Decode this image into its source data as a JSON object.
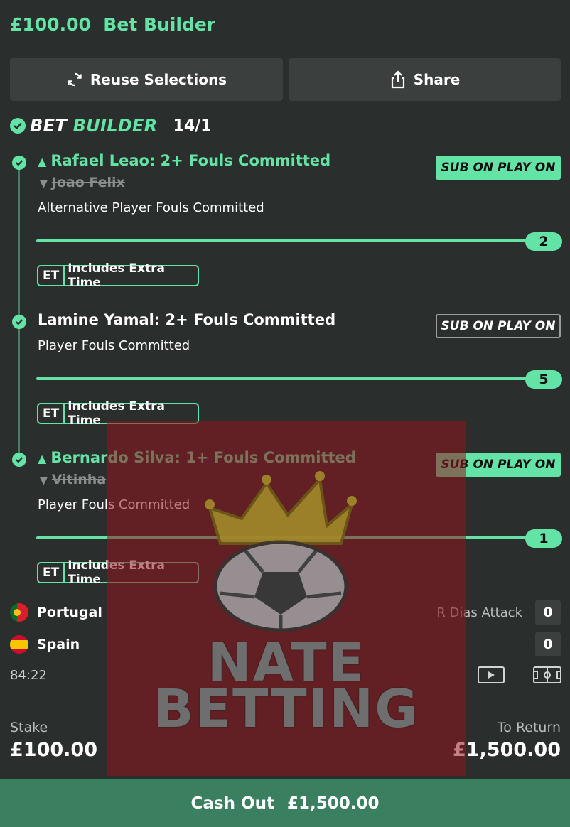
{
  "header": {
    "amount": "£100.00",
    "title": "Bet Builder"
  },
  "actions": {
    "reuse_label": "Reuse Selections",
    "share_label": "Share"
  },
  "bet_builder": {
    "label_part1": "BET",
    "label_part2": "BUILDER",
    "odds": "14/1"
  },
  "legs": [
    {
      "title": "Rafael Leao: 2+ Fouls Committed",
      "struck_player": "Joao Felix",
      "market": "Alternative Player Fouls Committed",
      "sub_label": "SUB ON PLAY ON",
      "sub_active": true,
      "progress_value": "2",
      "et_short": "ET",
      "et_label": "Includes Extra Time"
    },
    {
      "title": "Lamine Yamal: 2+ Fouls Committed",
      "market": "Player Fouls Committed",
      "sub_label": "SUB ON PLAY ON",
      "sub_active": false,
      "progress_value": "5",
      "et_short": "ET",
      "et_label": "Includes Extra Time"
    },
    {
      "title": "Bernardo Silva: 1+ Fouls Committed",
      "struck_player": "Vitinha",
      "market": "Player Fouls Committed",
      "sub_label": "SUB ON PLAY ON",
      "sub_active": true,
      "progress_value": "1",
      "et_short": "ET",
      "et_label": "Includes Extra Time"
    }
  ],
  "match": {
    "home": "Portugal",
    "away": "Spain",
    "stat_label": "R Dias Attack",
    "home_score": "0",
    "away_score": "0",
    "clock": "84:22"
  },
  "summary": {
    "stake_label": "Stake",
    "stake_value": "£100.00",
    "return_label": "To Return",
    "return_value": "£1,500.00"
  },
  "cashout": {
    "label": "Cash Out",
    "value": "£1,500.00"
  },
  "watermark": {
    "line1": "NATE",
    "line2": "BETTING"
  },
  "colors": {
    "accent": "#63e3a6",
    "background": "#2a2e2d",
    "cashout_bar": "#3a8060"
  }
}
